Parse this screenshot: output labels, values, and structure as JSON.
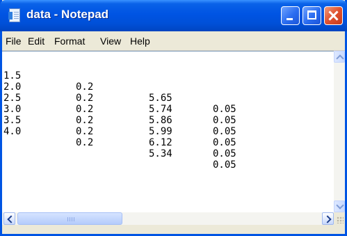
{
  "window": {
    "title": "data - Notepad"
  },
  "menu": [
    "File",
    "Edit",
    "Format",
    "View",
    "Help"
  ],
  "document": {
    "rows": [
      [
        "1.5",
        "0.2",
        "5.65",
        "0.05"
      ],
      [
        "2.0",
        "0.2",
        "5.74",
        "0.05"
      ],
      [
        "2.5",
        "0.2",
        "5.86",
        "0.05"
      ],
      [
        "3.0",
        "0.2",
        "5.99",
        "0.05"
      ],
      [
        "3.5",
        "0.2",
        "6.12",
        "0.05"
      ],
      [
        "4.0",
        "0.2",
        "5.34",
        "0.05"
      ]
    ]
  },
  "icons": {
    "app": "notepad-icon",
    "minimize": "minimize-icon",
    "maximize": "maximize-icon",
    "close": "close-icon"
  },
  "colors": {
    "titlebar": "#0054e3",
    "close_button": "#e0512e",
    "menubar": "#ece9d8",
    "editor_background": "#ffffff"
  }
}
